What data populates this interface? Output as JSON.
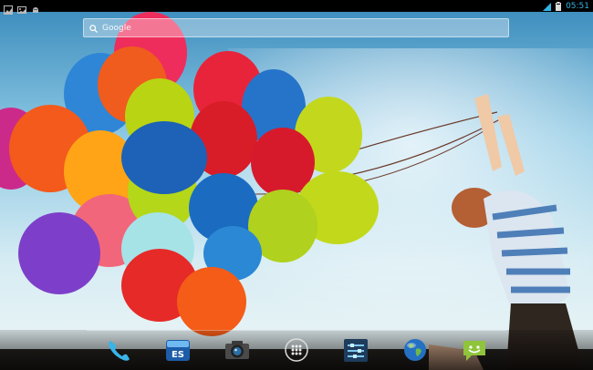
{
  "status_bar": {
    "notification_icons": [
      "photo-icon",
      "gallery-icon",
      "android-debug-icon"
    ],
    "status_icons": [
      "signal-icon",
      "battery-icon"
    ],
    "time": "05:51",
    "accent_color": "#33b5e5"
  },
  "search": {
    "placeholder": "Google"
  },
  "dock": {
    "apps": [
      "phone",
      "es-file-explorer",
      "camera",
      "all-apps",
      "settings",
      "browser",
      "messaging"
    ]
  }
}
